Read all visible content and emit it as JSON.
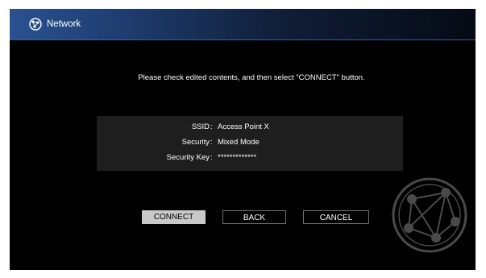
{
  "header": {
    "title": "Network",
    "icon": "network-globe-icon"
  },
  "message": "Please check edited contents, and then select \"CONNECT\" button.",
  "details": [
    {
      "label": "SSID",
      "separator": ":",
      "value": "Access Point X"
    },
    {
      "label": "Security",
      "separator": ":",
      "value": "Mixed Mode"
    },
    {
      "label": "Security Key",
      "separator": ":",
      "value": "*************"
    }
  ],
  "buttons": {
    "connect": "CONNECT",
    "back": "BACK",
    "cancel": "CANCEL"
  },
  "colors": {
    "background": "#000000",
    "header_start": "#2a5190",
    "header_end": "#050a14",
    "panel": "#1e1e1e",
    "selected_button": "#c9c9c9",
    "text": "#ffffff"
  },
  "decorations": {
    "watermark_icon": "network-globe-watermark-icon"
  },
  "state": {
    "selected_button": "connect"
  }
}
